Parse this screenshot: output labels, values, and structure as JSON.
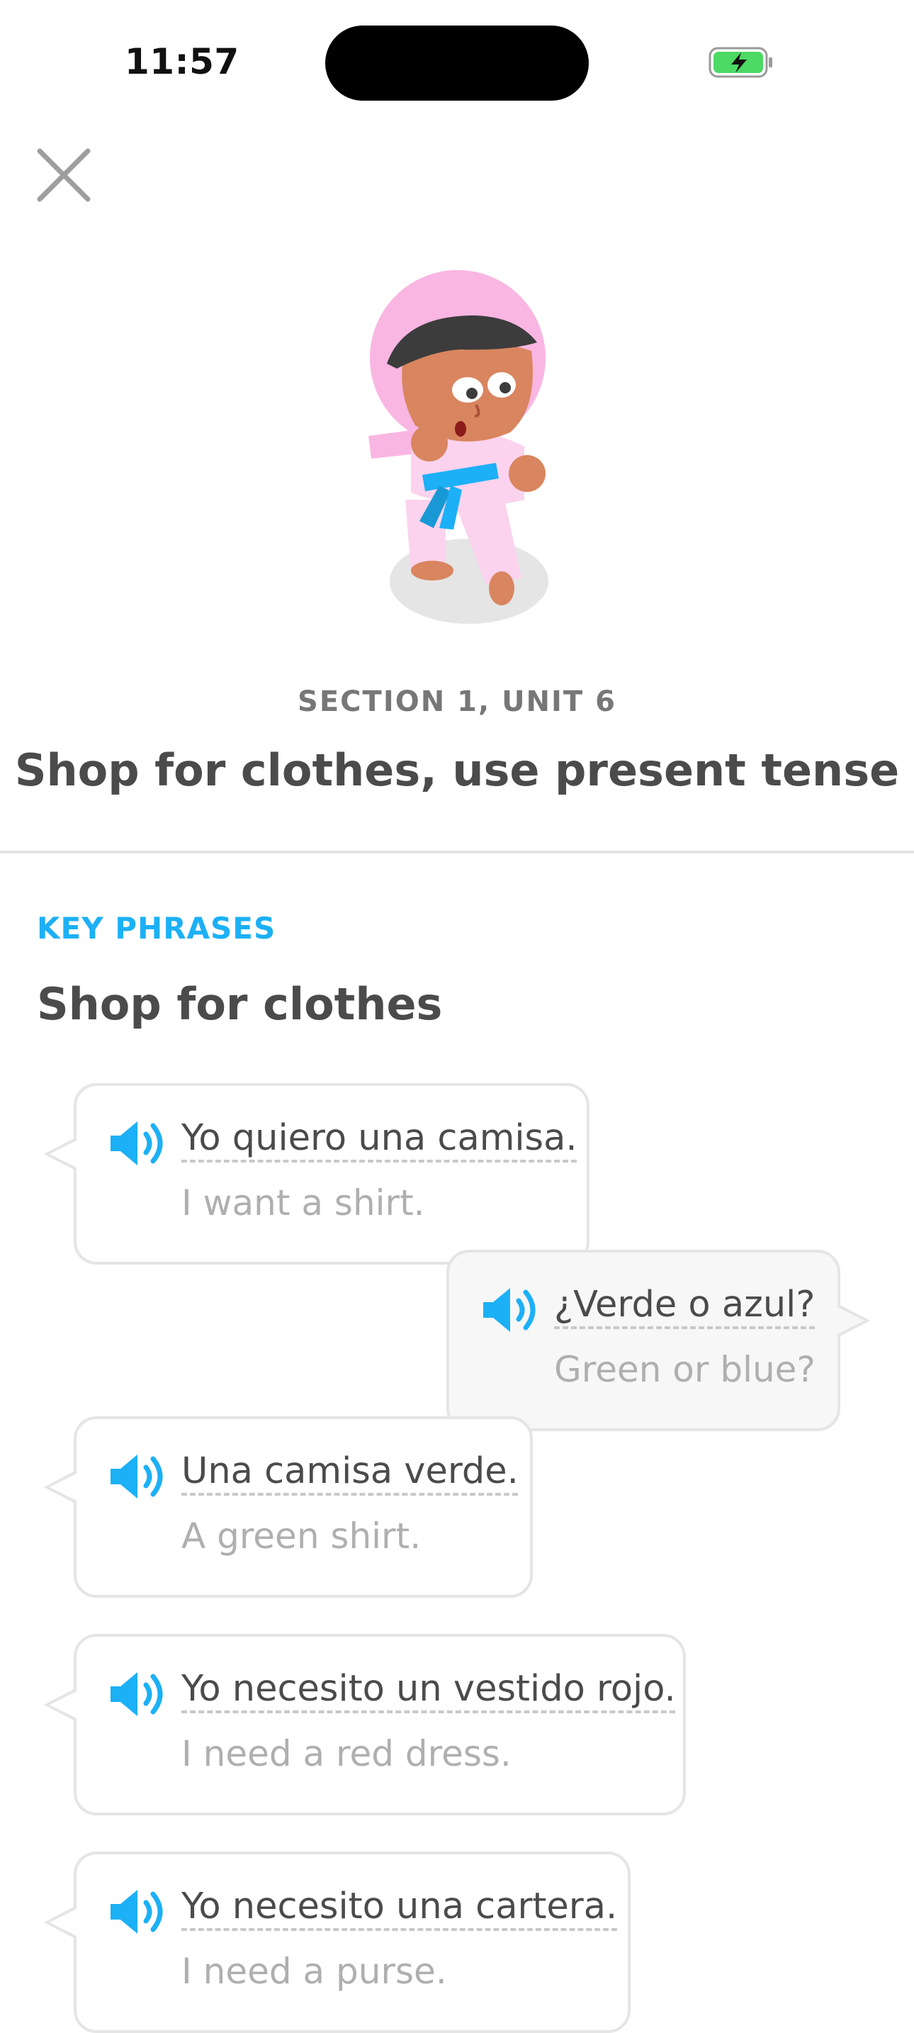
{
  "status_bar": {
    "time": "11:57"
  },
  "header": {
    "section_label": "SECTION 1, UNIT 6",
    "unit_title": "Shop for clothes, use present tense"
  },
  "key_phrases": {
    "label": "KEY PHRASES",
    "title": "Shop for clothes",
    "phrases": [
      {
        "text": "Yo quiero una camisa.",
        "translation": "I want a shirt.",
        "side": "left"
      },
      {
        "text": "¿Verde o azul?",
        "translation": "Green or blue?",
        "side": "right"
      },
      {
        "text": "Una camisa verde.",
        "translation": "A green shirt.",
        "side": "left"
      },
      {
        "text": "Yo necesito un vestido rojo.",
        "translation": "I need a red dress.",
        "side": "left"
      },
      {
        "text": "Yo necesito una cartera.",
        "translation": "I need a purse.",
        "side": "left"
      }
    ]
  },
  "colors": {
    "accent_blue": "#1cb0f6",
    "text_dark": "#4b4b4b",
    "text_muted": "#afafaf",
    "border": "#e5e5e5",
    "battery_green": "#4cd964"
  }
}
